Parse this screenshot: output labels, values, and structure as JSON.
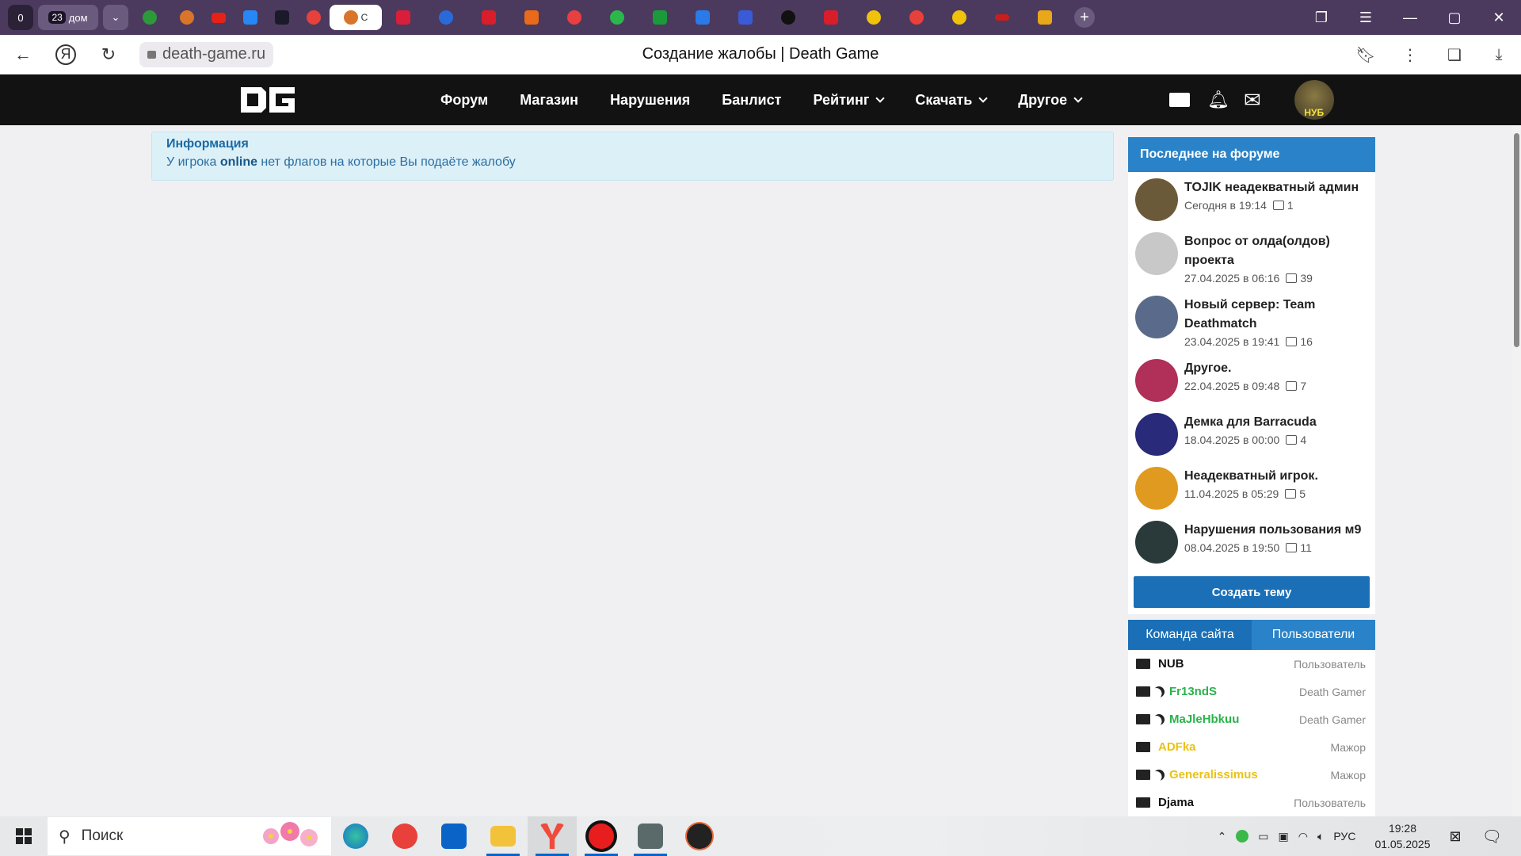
{
  "browser": {
    "tab_counter": "0",
    "group_count": "23",
    "group_label": "дом",
    "tab_plus": "+",
    "active_tab_letter": "С",
    "url": "death-game.ru",
    "page_title": "Создание жалобы | Death Game"
  },
  "site": {
    "nav": [
      {
        "label": "Форум",
        "dropdown": false
      },
      {
        "label": "Магазин",
        "dropdown": false
      },
      {
        "label": "Нарушения",
        "dropdown": false
      },
      {
        "label": "Банлист",
        "dropdown": false
      },
      {
        "label": "Рейтинг",
        "dropdown": true
      },
      {
        "label": "Скачать",
        "dropdown": true
      },
      {
        "label": "Другое",
        "dropdown": true
      }
    ],
    "user_nick": "НУБ"
  },
  "info": {
    "title": "Информация",
    "text_before": "У игрока ",
    "player": "online",
    "text_after": " нет флагов на которые Вы подаёте жалобу"
  },
  "forum_latest": {
    "header": "Последнее на форуме",
    "threads": [
      {
        "title": "TOJIK неадекватный админ",
        "date": "Сегодня в 19:14",
        "replies": "1",
        "avatar_color": "#6b5a3a"
      },
      {
        "title": "Вопрос от олда(олдов) проекта",
        "date": "27.04.2025 в 06:16",
        "replies": "39",
        "avatar_color": "#c8c8c8"
      },
      {
        "title": "Новый сервер: Team Deathmatch",
        "date": "23.04.2025 в 19:41",
        "replies": "16",
        "avatar_color": "#5a6a8a"
      },
      {
        "title": "Другое.",
        "date": "22.04.2025 в 09:48",
        "replies": "7",
        "avatar_color": "#b0305a"
      },
      {
        "title": "Демка для Barracuda",
        "date": "18.04.2025 в 00:00",
        "replies": "4",
        "avatar_color": "#2a2a7a"
      },
      {
        "title": "Неадекватный игрок.",
        "date": "11.04.2025 в 05:29",
        "replies": "5",
        "avatar_color": "#e09a20"
      },
      {
        "title": "Нарушения пользования м9",
        "date": "08.04.2025 в 19:50",
        "replies": "11",
        "avatar_color": "#2a3a3a"
      }
    ],
    "create_button": "Создать тему"
  },
  "team": {
    "tabs": [
      "Команда сайта",
      "Пользователи"
    ],
    "members": [
      {
        "name": "NUB",
        "role": "Пользователь",
        "color": "#111111",
        "away": false
      },
      {
        "name": "Fr13ndS",
        "role": "Death Gamer",
        "color": "#2bb24c",
        "away": true
      },
      {
        "name": "MaJleHbkuu",
        "role": "Death Gamer",
        "color": "#2bb24c",
        "away": true
      },
      {
        "name": "ADFka",
        "role": "Мажор",
        "color": "#e8c21a",
        "away": false
      },
      {
        "name": "Generalissimus",
        "role": "Мажор",
        "color": "#e8c21a",
        "away": true
      },
      {
        "name": "Djama",
        "role": "Пользователь",
        "color": "#111111",
        "away": false
      }
    ]
  },
  "taskbar": {
    "search_placeholder": "Поиск",
    "lang": "РУС",
    "time": "19:28",
    "date": "01.05.2025"
  },
  "colors": {
    "accent": "#2a83c8",
    "button": "#1b6fb6",
    "header_bg": "#121212",
    "info_bg": "#dcf0f8"
  }
}
